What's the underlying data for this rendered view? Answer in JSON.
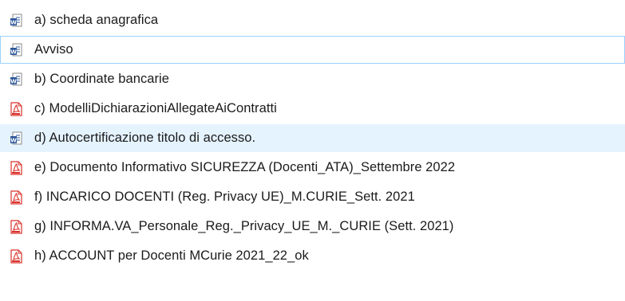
{
  "files": [
    {
      "name": "a) scheda anagrafica",
      "icon": "word-doc-icon",
      "state": "normal"
    },
    {
      "name": "Avviso",
      "icon": "word-doc-icon",
      "state": "focused"
    },
    {
      "name": "b) Coordinate bancarie",
      "icon": "word-doc-icon",
      "state": "normal"
    },
    {
      "name": "c) ModelliDichiarazioniAllegateAiContratti",
      "icon": "pdf-icon",
      "state": "normal"
    },
    {
      "name": "d) Autocertificazione titolo di accesso.",
      "icon": "word-doc-icon",
      "state": "hovered"
    },
    {
      "name": "e) Documento Informativo SICUREZZA (Docenti_ATA)_Settembre 2022",
      "icon": "pdf-icon",
      "state": "normal"
    },
    {
      "name": "f) INCARICO DOCENTI (Reg. Privacy UE)_M.CURIE_Sett. 2021",
      "icon": "pdf-icon",
      "state": "normal"
    },
    {
      "name": "g) INFORMA.VA_Personale_Reg._Privacy_UE_M._CURIE (Sett. 2021)",
      "icon": "pdf-icon",
      "state": "normal"
    },
    {
      "name": "h) ACCOUNT per Docenti MCurie 2021_22_ok",
      "icon": "pdf-icon",
      "state": "normal"
    }
  ],
  "colors": {
    "focus_border": "#99d1ff",
    "hover_background": "#e5f3ff",
    "word_blue": "#2b579a",
    "pdf_red": "#d9322b"
  }
}
